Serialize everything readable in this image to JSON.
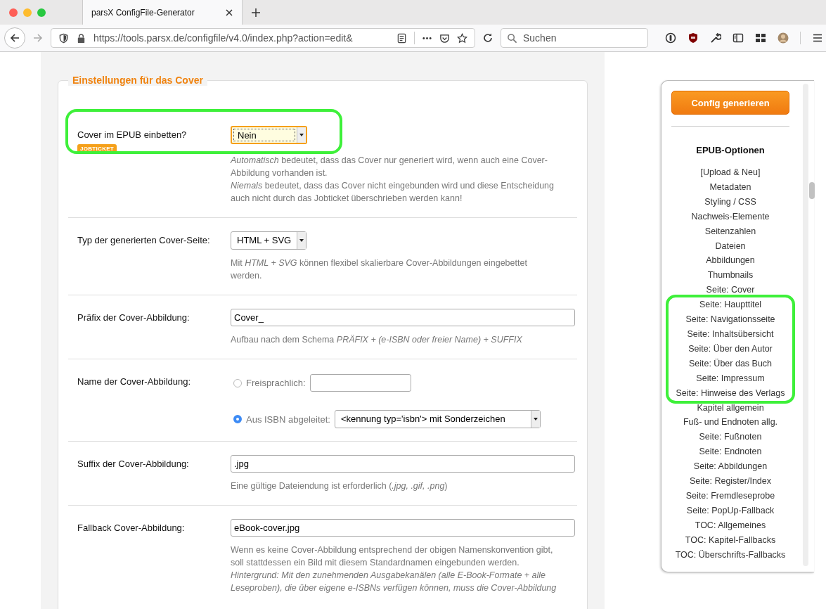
{
  "browser": {
    "tab_title": "parsX ConfigFile-Generator",
    "url": "https://tools.parsx.de/configfile/v4.0/index.php?action=edit&",
    "search_placeholder": "Suchen"
  },
  "section": {
    "title": "Einstellungen für das Cover",
    "fields": [
      {
        "kind": "select",
        "label": "Cover im EPUB einbetten?",
        "badge": "JOBTICKET",
        "value": "Nein",
        "focused": true,
        "highlighted": true,
        "help": [
          "*Automatisch* bedeutet, dass das Cover nur generiert wird, wenn auch eine Cover-Abbildung vorhanden ist.",
          "*Niemals* bedeutet, dass das Cover nicht eingebunden wird und diese Entscheidung auch nicht durch das Jobticket überschrieben werden kann!"
        ]
      },
      {
        "kind": "select",
        "label": "Typ der generierten Cover-Seite:",
        "value": "HTML + SVG",
        "focused": false,
        "highlighted": false,
        "help": [
          "Mit *HTML + SVG* können flexibel skalierbare Cover-Abbildungen eingebettet werden."
        ]
      },
      {
        "kind": "text",
        "label": "Präfix der Cover-Abbildung:",
        "value": "Cover_",
        "highlighted": false,
        "help": [
          "Aufbau nach dem Schema *PRÄFIX + (e-ISBN oder freier Name) + SUFFIX*"
        ]
      },
      {
        "kind": "radio",
        "label": "Name der Cover-Abbildung:",
        "highlighted": false,
        "options": [
          {
            "label": "Freisprachlich:",
            "selected": false,
            "kind": "text"
          },
          {
            "label": "Aus ISBN abgeleitet:",
            "selected": true,
            "kind": "select",
            "value": "<kennung typ='isbn'> mit Sonderzeichen"
          }
        ]
      },
      {
        "kind": "text",
        "label": "Suffix der Cover-Abbildung:",
        "value": ".jpg",
        "highlighted": false,
        "help": [
          "Eine gültige Dateiendung ist erforderlich (*.jpg, .gif, .png*)"
        ]
      },
      {
        "kind": "text",
        "label": "Fallback Cover-Abbildung:",
        "value": "eBook-cover.jpg",
        "highlighted": false,
        "help": [
          "Wenn es keine Cover-Abbildung entsprechend der obigen Namenskonvention gibt, soll stattdessen ein Bild mit diesem Standardnamen eingebunden werden.",
          "*Hintergrund: Mit den zunehmenden Ausgabekanälen (alle E-Book-Formate + alle Leseproben), die über eigene e-ISBNs verfügen können, muss die Cover-Abbildung*"
        ]
      }
    ]
  },
  "sidebar": {
    "button": "Config generieren",
    "heading": "EPUB-Optionen",
    "groups": [
      {
        "highlighted": false,
        "items": [
          "[Upload & Neu]",
          "Metadaten",
          "Styling / CSS",
          "Nachweis-Elemente",
          "Seitenzahlen",
          "Dateien",
          "Abbildungen",
          "Thumbnails",
          "Seite: Cover"
        ]
      },
      {
        "highlighted": true,
        "items": [
          "Seite: Haupttitel",
          "Seite: Navigationsseite",
          "Seite: Inhaltsübersicht",
          "Seite: Über den Autor",
          "Seite: Über das Buch",
          "Seite: Impressum",
          "Seite: Hinweise des Verlags"
        ]
      },
      {
        "highlighted": false,
        "items": [
          "Kapitel allgemein",
          "Fuß- und Endnoten allg.",
          "Seite: Fußnoten",
          "Seite: Endnoten",
          "Seite: Abbildungen",
          "Seite: Register/Index",
          "Seite: Fremdleseprobe",
          "Seite: PopUp-Fallback",
          "TOC: Allgemeines",
          "TOC: Kapitel-Fallbacks",
          "TOC: Überschrifts-Fallbacks"
        ]
      }
    ]
  }
}
